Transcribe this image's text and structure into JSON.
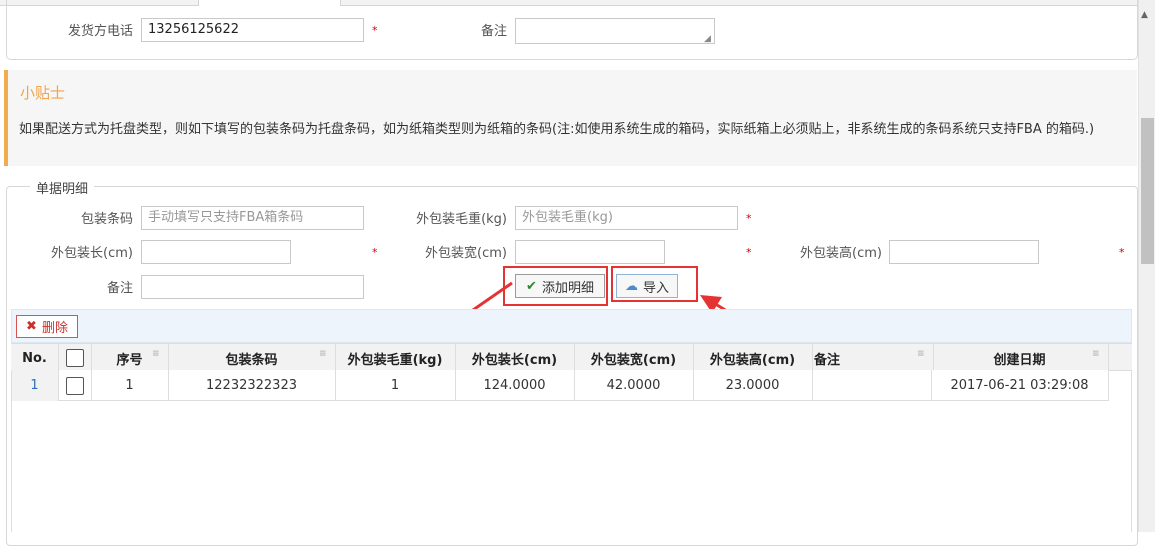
{
  "shipper": {
    "phone_label": "发货方电话",
    "phone_value": "13256125622",
    "required_mark": "*",
    "remark_label": "备注"
  },
  "tips": {
    "title": "小贴士",
    "text": "如果配送方式为托盘类型，则如下填写的包装条码为托盘条码，如为纸箱类型则为纸箱的条码(注:如使用系统生成的箱码，实际纸箱上必须贴上，非系统生成的条码系统只支持FBA 的箱码.)"
  },
  "detail": {
    "legend": "单据明细",
    "barcode_label": "包装条码",
    "barcode_placeholder": "手动填写只支持FBA箱条码",
    "weight_label": "外包装毛重(kg)",
    "weight_placeholder": "外包装毛重(kg)",
    "length_label": "外包装长(cm)",
    "width_label": "外包装宽(cm)",
    "height_label": "外包装高(cm)",
    "remark_label": "备注",
    "required_mark": "*",
    "add_button": "添加明细",
    "import_button": "导入"
  },
  "toolbar": {
    "delete_button": "删除"
  },
  "grid": {
    "headers": [
      "No.",
      "",
      "序号",
      "包装条码",
      "外包装毛重(kg)",
      "外包装长(cm)",
      "外包装宽(cm)",
      "外包装高(cm)",
      "备注",
      "创建日期"
    ],
    "rows": [
      [
        "1",
        "",
        "1",
        "12232322323",
        "1",
        "124.0000",
        "42.0000",
        "23.0000",
        "",
        "2017-06-21 03:29:08"
      ]
    ]
  },
  "colors": {
    "accent": "#f0ad4e",
    "required": "#cc0000",
    "annotation_red": "#e53333"
  }
}
